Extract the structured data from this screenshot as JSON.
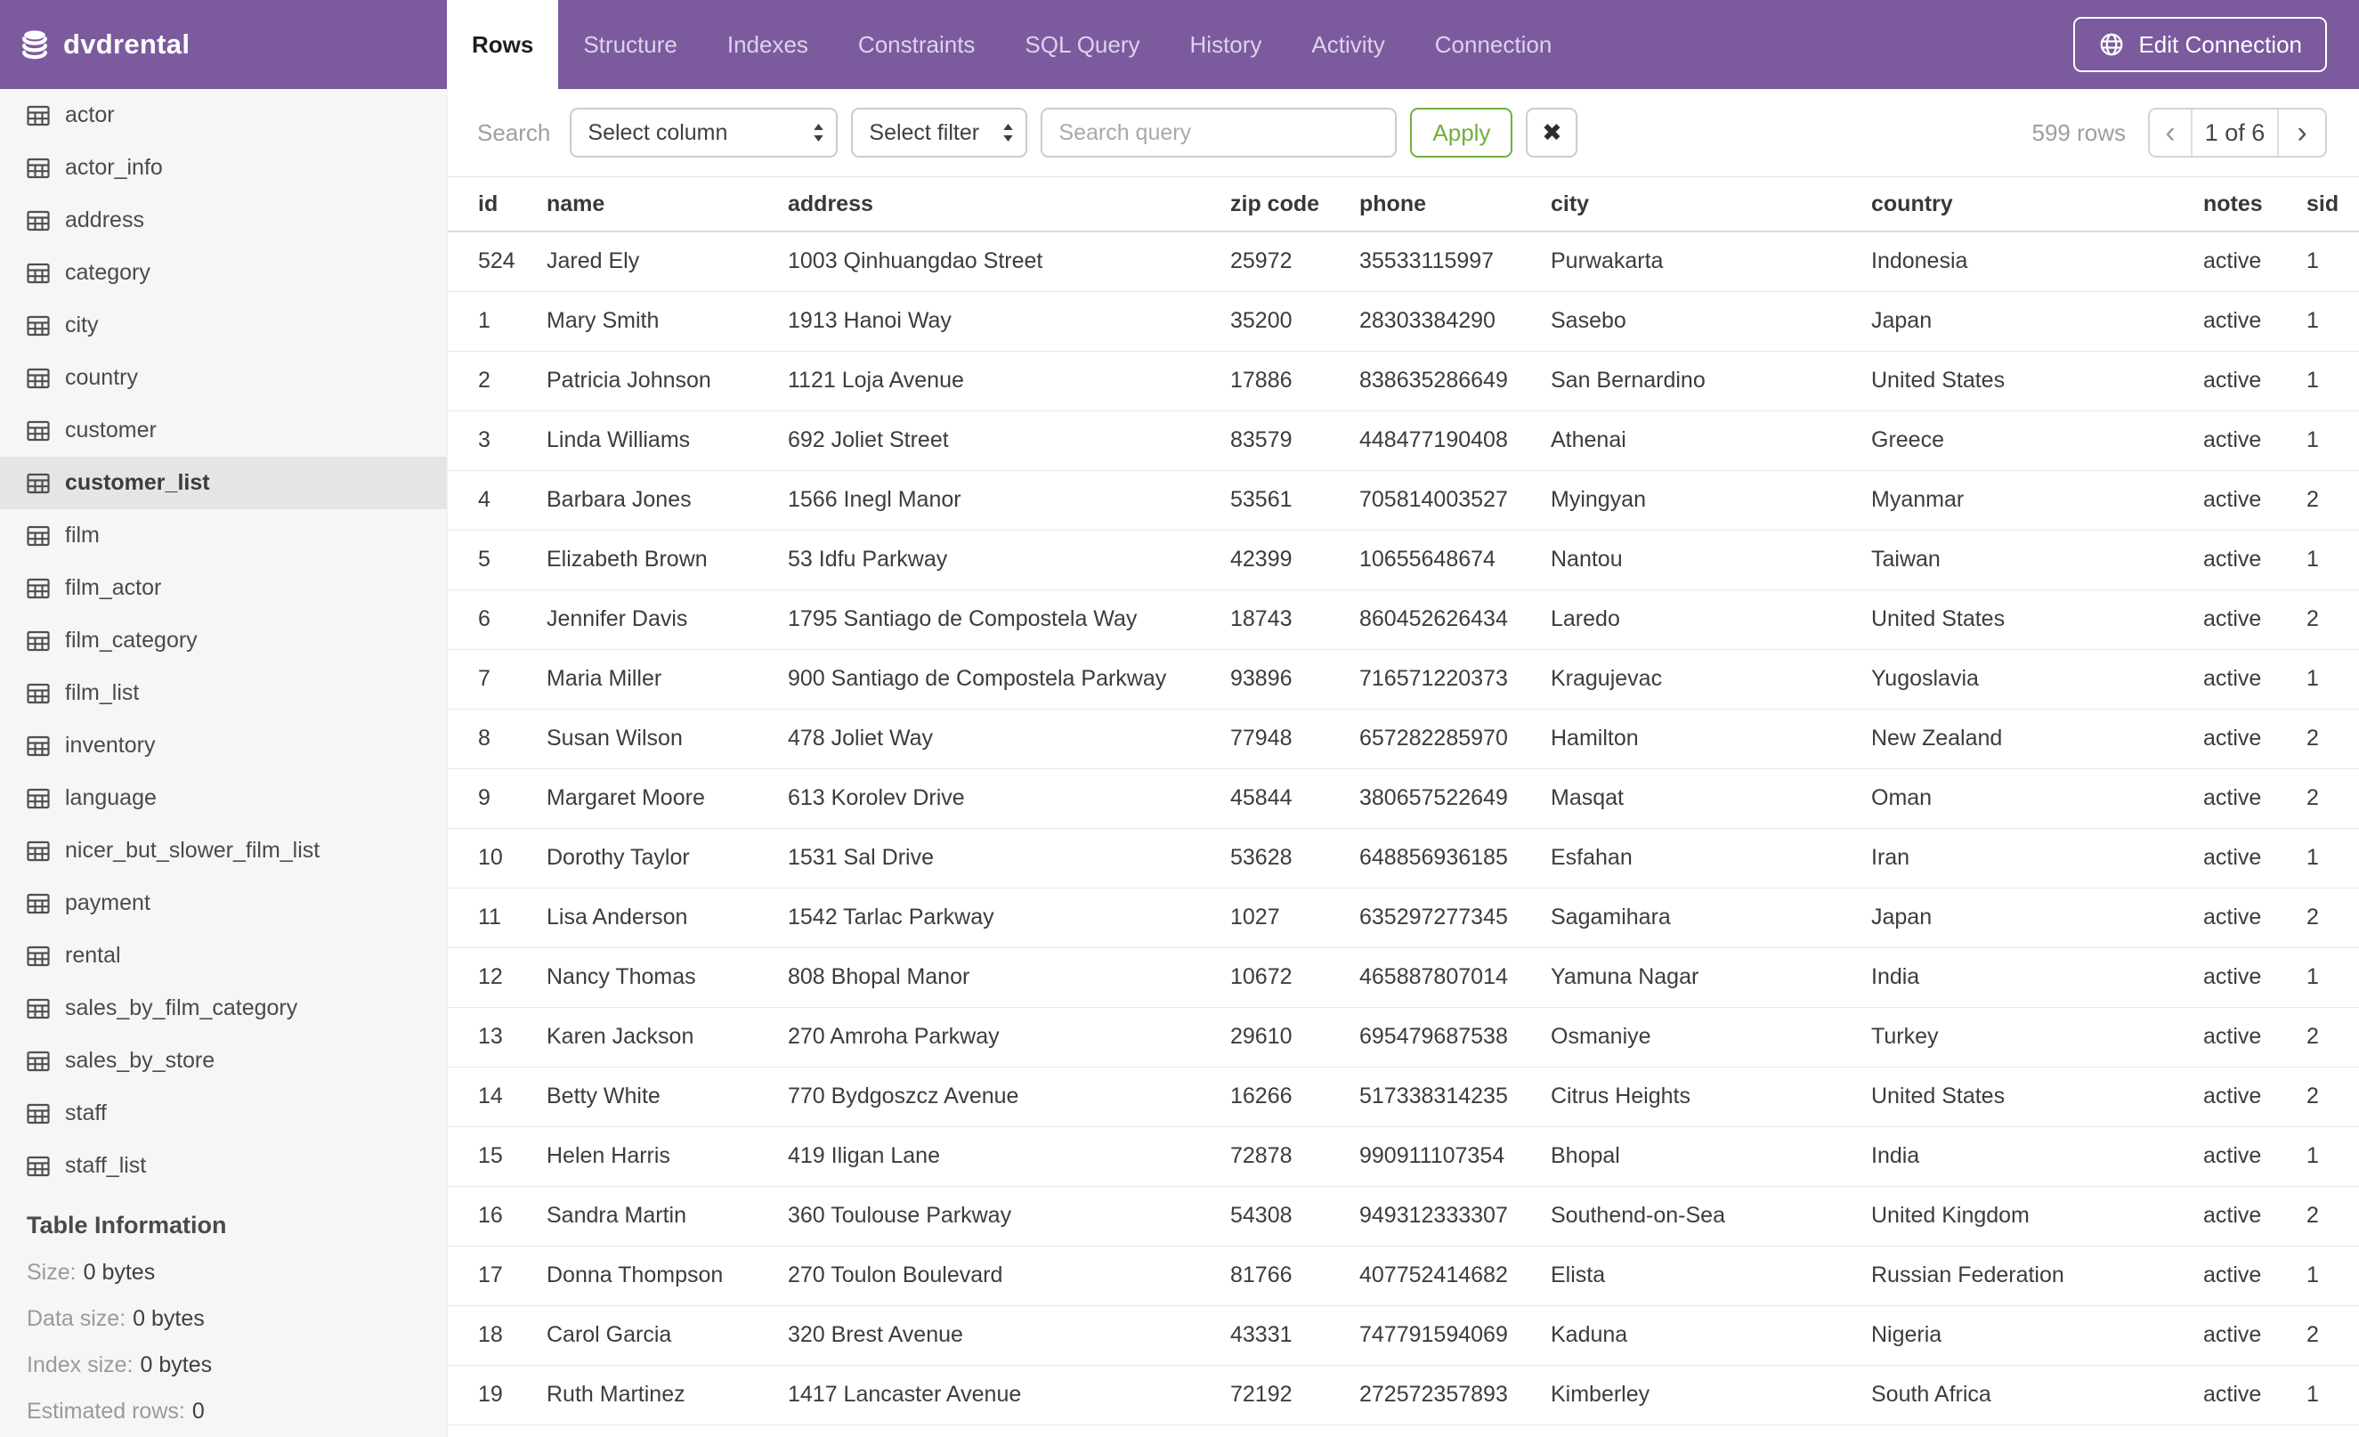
{
  "header": {
    "app_name": "dvdrental",
    "tabs": [
      {
        "label": "Rows",
        "active": true
      },
      {
        "label": "Structure"
      },
      {
        "label": "Indexes"
      },
      {
        "label": "Constraints"
      },
      {
        "label": "SQL Query"
      },
      {
        "label": "History"
      },
      {
        "label": "Activity"
      },
      {
        "label": "Connection"
      }
    ],
    "edit_connection_label": "Edit Connection"
  },
  "sidebar": {
    "tables": [
      {
        "label": "actor"
      },
      {
        "label": "actor_info"
      },
      {
        "label": "address"
      },
      {
        "label": "category"
      },
      {
        "label": "city"
      },
      {
        "label": "country"
      },
      {
        "label": "customer"
      },
      {
        "label": "customer_list",
        "selected": true
      },
      {
        "label": "film"
      },
      {
        "label": "film_actor"
      },
      {
        "label": "film_category"
      },
      {
        "label": "film_list"
      },
      {
        "label": "inventory"
      },
      {
        "label": "language"
      },
      {
        "label": "nicer_but_slower_film_list"
      },
      {
        "label": "payment"
      },
      {
        "label": "rental"
      },
      {
        "label": "sales_by_film_category"
      },
      {
        "label": "sales_by_store"
      },
      {
        "label": "staff"
      },
      {
        "label": "staff_list"
      }
    ],
    "info": {
      "title": "Table Information",
      "rows": [
        {
          "label": "Size:",
          "value": "0 bytes"
        },
        {
          "label": "Data size:",
          "value": "0 bytes"
        },
        {
          "label": "Index size:",
          "value": "0 bytes"
        },
        {
          "label": "Estimated rows:",
          "value": "0"
        }
      ]
    }
  },
  "toolbar": {
    "search_label": "Search",
    "column_select_value": "Select column",
    "filter_select_value": "Select filter",
    "query_placeholder": "Search query",
    "query_value": "",
    "apply_label": "Apply",
    "clear_icon": "✖",
    "row_count": "599 rows",
    "pager": {
      "prev": "‹",
      "current": "1 of 6",
      "next": "›"
    }
  },
  "accent_colors": {
    "header_purple": "#7b5b9e",
    "apply_green": "#6fb03c",
    "selected_row_gray": "#e5e5e5"
  },
  "table": {
    "columns": [
      "id",
      "name",
      "address",
      "zip code",
      "phone",
      "city",
      "country",
      "notes",
      "sid"
    ],
    "rows": [
      {
        "id": "524",
        "name": "Jared Ely",
        "address": "1003 Qinhuangdao Street",
        "zip": "25972",
        "phone": "35533115997",
        "city": "Purwakarta",
        "country": "Indonesia",
        "notes": "active",
        "sid": "1"
      },
      {
        "id": "1",
        "name": "Mary Smith",
        "address": "1913 Hanoi Way",
        "zip": "35200",
        "phone": "28303384290",
        "city": "Sasebo",
        "country": "Japan",
        "notes": "active",
        "sid": "1"
      },
      {
        "id": "2",
        "name": "Patricia Johnson",
        "address": "1121 Loja Avenue",
        "zip": "17886",
        "phone": "838635286649",
        "city": "San Bernardino",
        "country": "United States",
        "notes": "active",
        "sid": "1"
      },
      {
        "id": "3",
        "name": "Linda Williams",
        "address": "692 Joliet Street",
        "zip": "83579",
        "phone": "448477190408",
        "city": "Athenai",
        "country": "Greece",
        "notes": "active",
        "sid": "1"
      },
      {
        "id": "4",
        "name": "Barbara Jones",
        "address": "1566 Inegl Manor",
        "zip": "53561",
        "phone": "705814003527",
        "city": "Myingyan",
        "country": "Myanmar",
        "notes": "active",
        "sid": "2"
      },
      {
        "id": "5",
        "name": "Elizabeth Brown",
        "address": "53 Idfu Parkway",
        "zip": "42399",
        "phone": "10655648674",
        "city": "Nantou",
        "country": "Taiwan",
        "notes": "active",
        "sid": "1"
      },
      {
        "id": "6",
        "name": "Jennifer Davis",
        "address": "1795 Santiago de Compostela Way",
        "zip": "18743",
        "phone": "860452626434",
        "city": "Laredo",
        "country": "United States",
        "notes": "active",
        "sid": "2"
      },
      {
        "id": "7",
        "name": "Maria Miller",
        "address": "900 Santiago de Compostela Parkway",
        "zip": "93896",
        "phone": "716571220373",
        "city": "Kragujevac",
        "country": "Yugoslavia",
        "notes": "active",
        "sid": "1"
      },
      {
        "id": "8",
        "name": "Susan Wilson",
        "address": "478 Joliet Way",
        "zip": "77948",
        "phone": "657282285970",
        "city": "Hamilton",
        "country": "New Zealand",
        "notes": "active",
        "sid": "2"
      },
      {
        "id": "9",
        "name": "Margaret Moore",
        "address": "613 Korolev Drive",
        "zip": "45844",
        "phone": "380657522649",
        "city": "Masqat",
        "country": "Oman",
        "notes": "active",
        "sid": "2"
      },
      {
        "id": "10",
        "name": "Dorothy Taylor",
        "address": "1531 Sal Drive",
        "zip": "53628",
        "phone": "648856936185",
        "city": "Esfahan",
        "country": "Iran",
        "notes": "active",
        "sid": "1"
      },
      {
        "id": "11",
        "name": "Lisa Anderson",
        "address": "1542 Tarlac Parkway",
        "zip": "1027",
        "phone": "635297277345",
        "city": "Sagamihara",
        "country": "Japan",
        "notes": "active",
        "sid": "2"
      },
      {
        "id": "12",
        "name": "Nancy Thomas",
        "address": "808 Bhopal Manor",
        "zip": "10672",
        "phone": "465887807014",
        "city": "Yamuna Nagar",
        "country": "India",
        "notes": "active",
        "sid": "1"
      },
      {
        "id": "13",
        "name": "Karen Jackson",
        "address": "270 Amroha Parkway",
        "zip": "29610",
        "phone": "695479687538",
        "city": "Osmaniye",
        "country": "Turkey",
        "notes": "active",
        "sid": "2"
      },
      {
        "id": "14",
        "name": "Betty White",
        "address": "770 Bydgoszcz Avenue",
        "zip": "16266",
        "phone": "517338314235",
        "city": "Citrus Heights",
        "country": "United States",
        "notes": "active",
        "sid": "2"
      },
      {
        "id": "15",
        "name": "Helen Harris",
        "address": "419 Iligan Lane",
        "zip": "72878",
        "phone": "990911107354",
        "city": "Bhopal",
        "country": "India",
        "notes": "active",
        "sid": "1"
      },
      {
        "id": "16",
        "name": "Sandra Martin",
        "address": "360 Toulouse Parkway",
        "zip": "54308",
        "phone": "949312333307",
        "city": "Southend-on-Sea",
        "country": "United Kingdom",
        "notes": "active",
        "sid": "2"
      },
      {
        "id": "17",
        "name": "Donna Thompson",
        "address": "270 Toulon Boulevard",
        "zip": "81766",
        "phone": "407752414682",
        "city": "Elista",
        "country": "Russian Federation",
        "notes": "active",
        "sid": "1"
      },
      {
        "id": "18",
        "name": "Carol Garcia",
        "address": "320 Brest Avenue",
        "zip": "43331",
        "phone": "747791594069",
        "city": "Kaduna",
        "country": "Nigeria",
        "notes": "active",
        "sid": "2"
      },
      {
        "id": "19",
        "name": "Ruth Martinez",
        "address": "1417 Lancaster Avenue",
        "zip": "72192",
        "phone": "272572357893",
        "city": "Kimberley",
        "country": "South Africa",
        "notes": "active",
        "sid": "1"
      }
    ]
  }
}
